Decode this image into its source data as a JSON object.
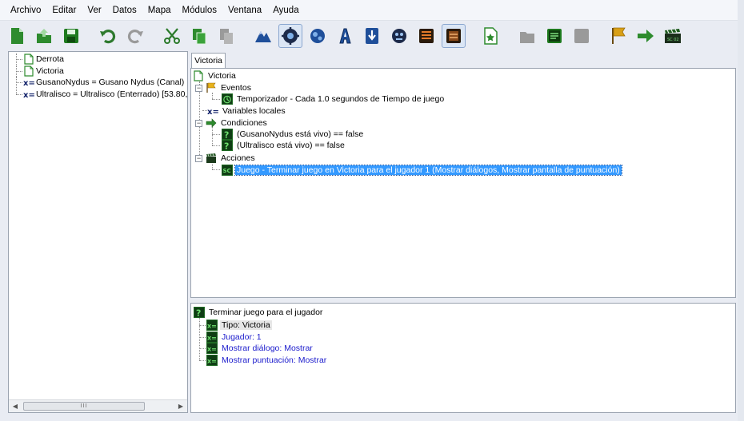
{
  "menu": [
    "Archivo",
    "Editar",
    "Ver",
    "Datos",
    "Mapa",
    "Módulos",
    "Ventana",
    "Ayuda"
  ],
  "toolbar": {
    "buttons": [
      {
        "icon": "new-document-icon",
        "color": "#2e8b2e"
      },
      {
        "icon": "open-icon",
        "color": "#2e8b2e"
      },
      {
        "icon": "save-icon",
        "color": "#1e7a1e"
      },
      {
        "icon": "undo-icon",
        "color": "#2e7a2e"
      },
      {
        "icon": "redo-icon",
        "color": "#9a9a9a"
      },
      {
        "icon": "cut-icon",
        "color": "#2a7a2a"
      },
      {
        "icon": "copy-icon",
        "color": "#2e8b2e"
      },
      {
        "icon": "paste-icon",
        "color": "#9a9a9a"
      },
      {
        "icon": "terrain-module-icon",
        "color": "#1f4f9a"
      },
      {
        "icon": "trigger-module-icon",
        "color": "#1c2a4a",
        "active": true
      },
      {
        "icon": "unit-module-icon",
        "color": "#1f4f9a"
      },
      {
        "icon": "ai-module-icon",
        "color": "#1f4f9a"
      },
      {
        "icon": "import-module-icon",
        "color": "#1f4f9a"
      },
      {
        "icon": "sound-module-icon",
        "color": "#1c2a4a"
      },
      {
        "icon": "list-module-icon",
        "color": "#8a4a1a"
      },
      {
        "icon": "text-module-icon",
        "color": "#8a4a1a",
        "active": true
      },
      {
        "icon": "new-trigger-icon",
        "color": "#2e8b2e"
      },
      {
        "icon": "new-folder-icon",
        "color": "#9a9a9a"
      },
      {
        "icon": "new-comment-icon",
        "color": "#1e7a1e"
      },
      {
        "icon": "disabled-icon",
        "color": "#9a9a9a"
      },
      {
        "icon": "new-event-icon",
        "color": "#d9a016"
      },
      {
        "icon": "new-condition-icon",
        "color": "#2e8b2e"
      },
      {
        "icon": "new-action-icon",
        "color": "#1e5a1e"
      }
    ]
  },
  "left_tree": {
    "items": [
      {
        "type": "trigger",
        "label": "Derrota"
      },
      {
        "type": "trigger",
        "label": "Victoria"
      },
      {
        "type": "variable",
        "label": "GusanoNydus = Gusano Nydus (Canal) [4"
      },
      {
        "type": "variable",
        "label": "Ultralisco = Ultralisco  (Enterrado) [53.80,"
      }
    ],
    "scroll_marker": "III"
  },
  "tab": {
    "label": "Victoria"
  },
  "trigger_tree": {
    "root": "Victoria",
    "eventos": "Eventos",
    "event_item": "Temporizador - Cada 1.0 segundos de Tiempo de juego",
    "variables": "Variables locales",
    "condiciones": "Condiciones",
    "conditions": [
      "(GusanoNydus está vivo) == false",
      "(Ultralisco está vivo) == false"
    ],
    "acciones": "Acciones",
    "action_item": "Juego - Terminar juego en Victoria para el jugador 1 (Mostrar diálogos, Mostrar pantalla de puntuación)"
  },
  "detail_tree": {
    "root": "Terminar juego para el jugador",
    "params": [
      {
        "label": "Tipo: Victoria",
        "style": "black"
      },
      {
        "label": "Jugador: 1",
        "style": "blue"
      },
      {
        "label": "Mostrar diálogo: Mostrar",
        "style": "blue"
      },
      {
        "label": "Mostrar puntuación: Mostrar",
        "style": "blue"
      }
    ]
  }
}
